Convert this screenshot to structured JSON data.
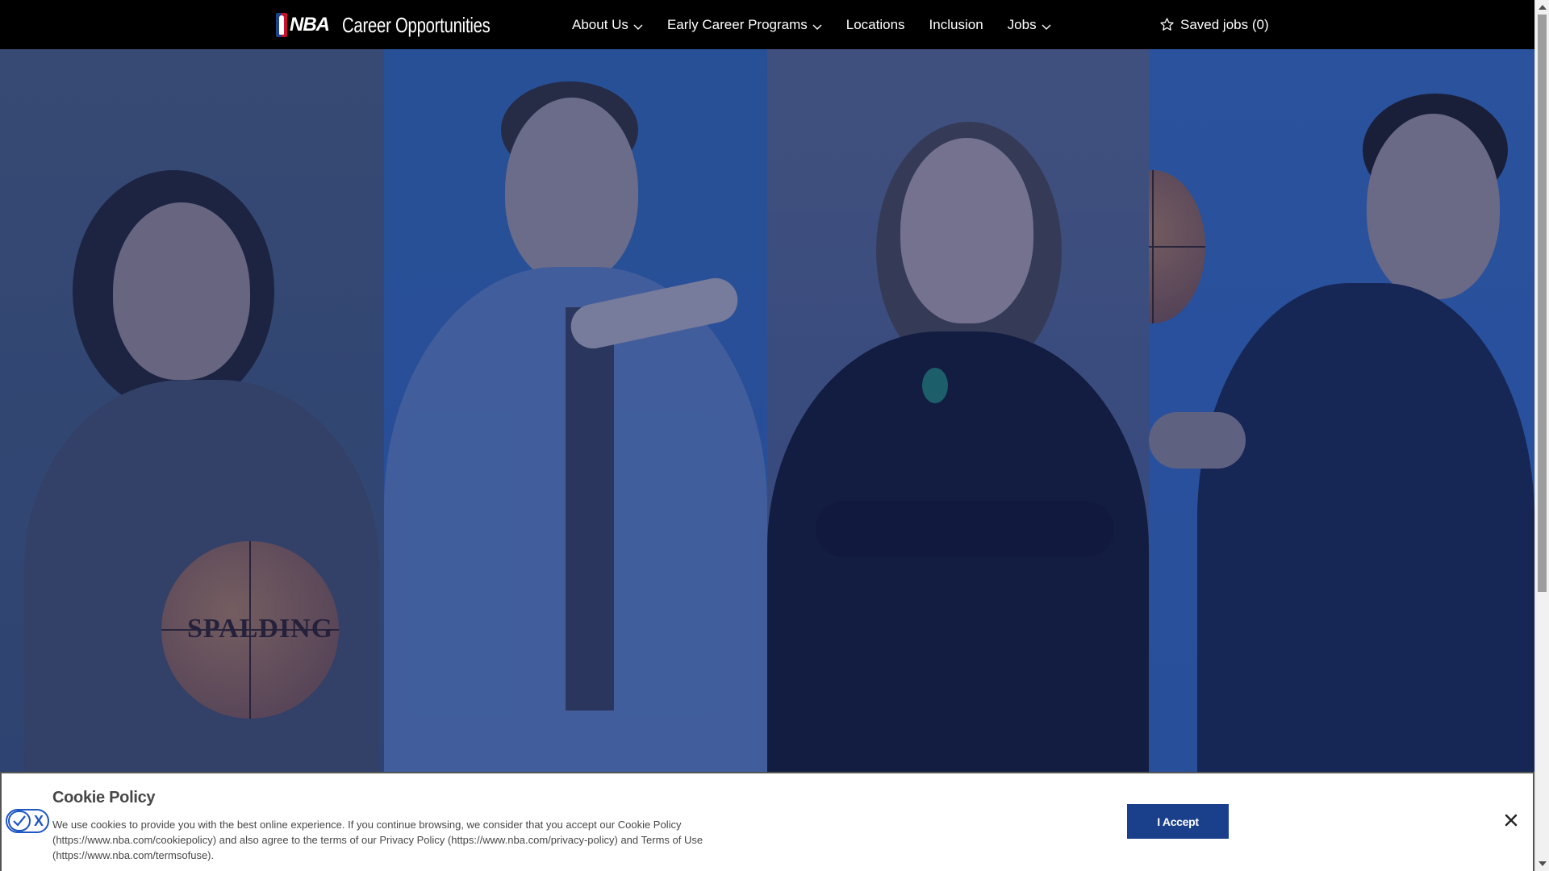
{
  "header": {
    "brand_word": "NBA",
    "site_title": "Career Opportunities",
    "nav": [
      {
        "label": "About Us",
        "has_dropdown": true
      },
      {
        "label": "Early Career Programs",
        "has_dropdown": true
      },
      {
        "label": "Locations",
        "has_dropdown": false
      },
      {
        "label": "Inclusion",
        "has_dropdown": false
      },
      {
        "label": "Jobs",
        "has_dropdown": true
      }
    ],
    "saved_jobs": "Saved jobs (0)"
  },
  "hero": {
    "ball_brand": "SPALDING"
  },
  "cookie_banner": {
    "title": "Cookie Policy",
    "text": "We use cookies to provide you with the best online experience. If you continue browsing, we consider that you accept our Cookie Policy (https://www.nba.com/cookiepolicy) and also agree to the terms of our Privacy Policy (https://www.nba.com/privacy-policy) and Terms of Use (https://www.nba.com/termsofuse).",
    "accept_label": "I Accept",
    "close_symbol": "×"
  },
  "colors": {
    "nav_bg": "#000000",
    "accept_button": "#1a3f8b",
    "toggle_accent": "#1e56c4"
  },
  "icons": [
    "nba-logo-icon",
    "chevron-down-icon",
    "star-icon",
    "check-icon",
    "close-icon"
  ]
}
